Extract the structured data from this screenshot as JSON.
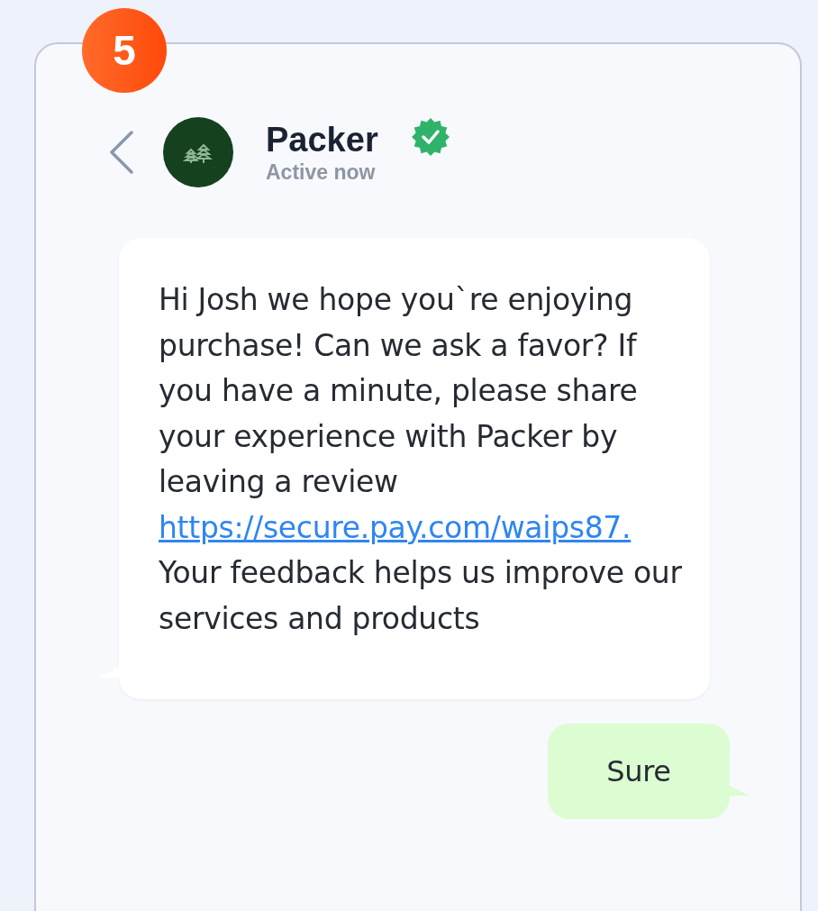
{
  "step_badge": "5",
  "contact": {
    "name": "Packer",
    "status": "Active now",
    "verified": true
  },
  "messages": [
    {
      "kind": "incoming",
      "parts": [
        {
          "kind": "text",
          "text": "Hi Josh we hope you`re enjoying purchase! Can we ask a favor? If you have a minute, please share your experience with Packer by leaving a review"
        },
        {
          "kind": "link",
          "text": "https://secure.pay.com/waips87."
        },
        {
          "kind": "text",
          "text": "Your feedback helps us improve our services and products"
        }
      ]
    },
    {
      "kind": "outgoing",
      "parts": [
        {
          "kind": "text",
          "text": "Sure"
        }
      ]
    }
  ]
}
